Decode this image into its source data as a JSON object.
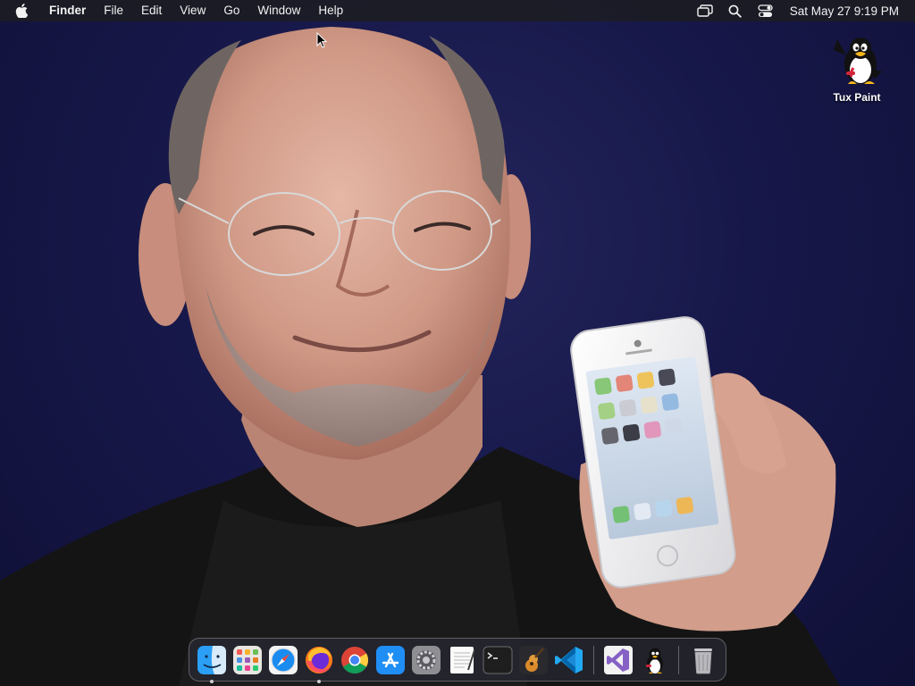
{
  "menubar": {
    "apple_icon": "apple-logo-icon",
    "app_name": "Finder",
    "menus": [
      "File",
      "Edit",
      "View",
      "Go",
      "Window",
      "Help"
    ],
    "status_icons": [
      "screen-mirroring-icon",
      "spotlight-search-icon",
      "control-center-icon"
    ],
    "clock": "Sat May 27  9:19 PM"
  },
  "desktop": {
    "icons": [
      {
        "label": "Tux Paint",
        "icon": "tux-paint-icon"
      }
    ],
    "wallpaper": "photo-man-holding-phone"
  },
  "dock": {
    "apps": [
      {
        "name": "Finder",
        "icon": "finder-icon",
        "running": true
      },
      {
        "name": "Launchpad",
        "icon": "launchpad-icon",
        "running": false
      },
      {
        "name": "Safari",
        "icon": "safari-icon",
        "running": false
      },
      {
        "name": "Firefox",
        "icon": "firefox-icon",
        "running": true
      },
      {
        "name": "Chrome",
        "icon": "chrome-icon",
        "running": false
      },
      {
        "name": "App Store",
        "icon": "app-store-icon",
        "running": false
      },
      {
        "name": "System Preferences",
        "icon": "system-preferences-icon",
        "running": false
      },
      {
        "name": "TextEdit",
        "icon": "textedit-icon",
        "running": false
      },
      {
        "name": "Terminal",
        "icon": "terminal-icon",
        "running": false
      },
      {
        "name": "GarageBand",
        "icon": "garageband-icon",
        "running": false
      },
      {
        "name": "Visual Studio Code",
        "icon": "vscode-icon",
        "running": false
      }
    ],
    "recent": [
      {
        "name": "Visual Studio",
        "icon": "visual-studio-icon",
        "running": false
      },
      {
        "name": "Tux Paint",
        "icon": "tux-paint-icon",
        "running": false
      }
    ],
    "trash": {
      "name": "Trash",
      "icon": "trash-icon"
    }
  },
  "colors": {
    "menubar_bg": "#1c1c24",
    "wallpaper_bg": "#17184a",
    "dock_bg": "#282834",
    "finder_blue": "#1e8df0",
    "vscode_blue": "#23a9f2",
    "vs_purple": "#8661c5"
  }
}
